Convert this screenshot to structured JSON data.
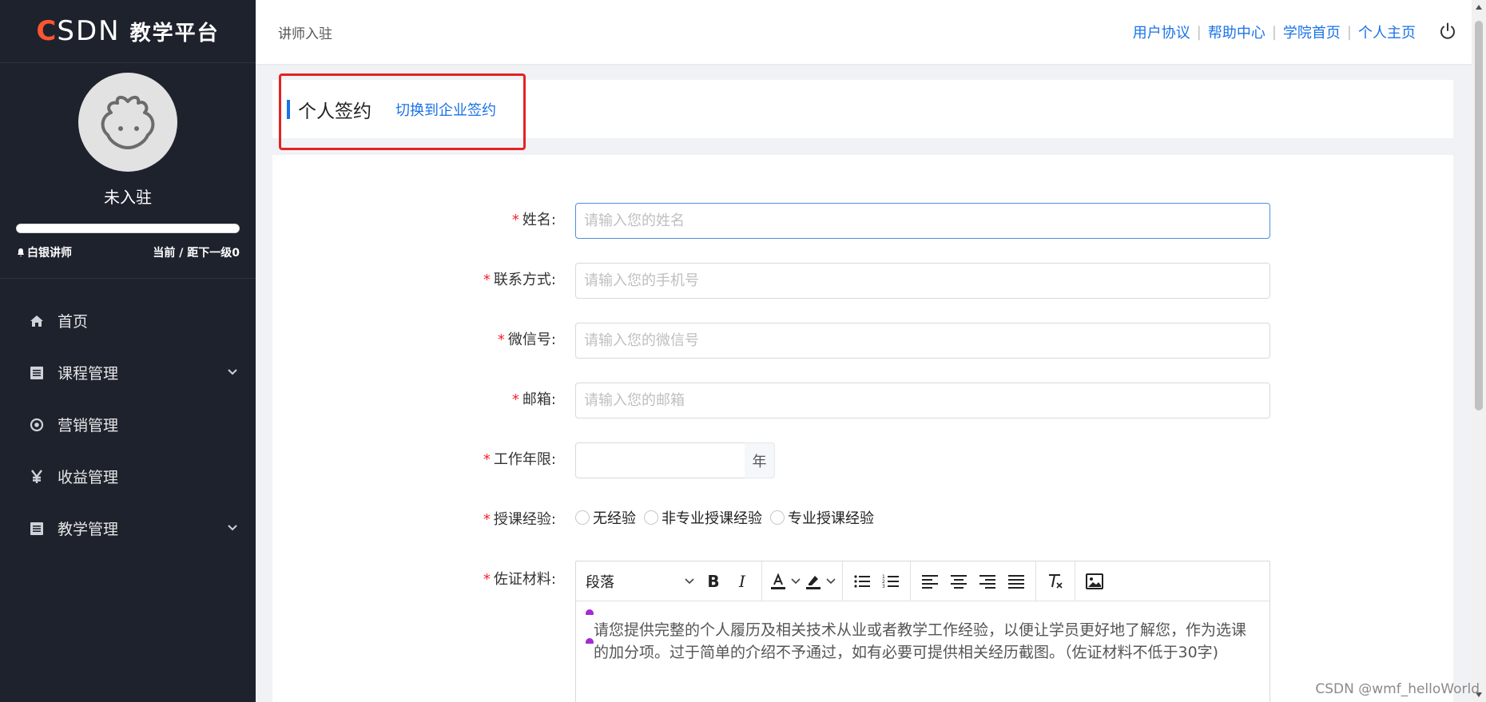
{
  "brand": {
    "logo_c": "C",
    "logo_sdn": "SDN",
    "title": "教学平台"
  },
  "user": {
    "name": "未入驻",
    "progress": 1.0,
    "level": "白银讲师",
    "level_info": "当前 / 距下一级0"
  },
  "menu": [
    {
      "label": "首页",
      "icon": "home-icon",
      "arrow": false
    },
    {
      "label": "课程管理",
      "icon": "list-icon",
      "arrow": true
    },
    {
      "label": "营销管理",
      "icon": "target-icon",
      "arrow": false
    },
    {
      "label": "收益管理",
      "icon": "yen-icon",
      "arrow": false
    },
    {
      "label": "教学管理",
      "icon": "list-icon",
      "arrow": true
    }
  ],
  "header": {
    "title": "讲师入驻",
    "links": [
      "用户协议",
      "帮助中心",
      "学院首页",
      "个人主页"
    ]
  },
  "sign_type": {
    "title": "个人签约",
    "switch": "切换到企业签约"
  },
  "form": {
    "name": {
      "label": "姓名:",
      "placeholder": "请输入您的姓名"
    },
    "contact": {
      "label": "联系方式:",
      "placeholder": "请输入您的手机号"
    },
    "wechat": {
      "label": "微信号:",
      "placeholder": "请输入您的微信号"
    },
    "email": {
      "label": "邮箱:",
      "placeholder": "请输入您的邮箱"
    },
    "years": {
      "label": "工作年限:",
      "unit": "年"
    },
    "experience": {
      "label": "授课经验:",
      "options": [
        "无经验",
        "非专业授课经验",
        "专业授课经验"
      ]
    },
    "materials": {
      "label": "佐证材料:",
      "format": "段落",
      "content": "请您提供完整的个人履历及相关技术从业或者教学工作经验，以便让学员更好地了解您，作为选课的加分项。过于简单的介绍不予通过，如有必要可提供相关经历截图。（佐证材料不低于30字)"
    }
  },
  "watermark": "CSDN @wmf_helloWorld",
  "colors": {
    "accent": "#1a73e8",
    "required": "#f5222d",
    "highlight": "#e52222",
    "sidebar": "#1e222d",
    "brand_red": "#fc5531"
  }
}
